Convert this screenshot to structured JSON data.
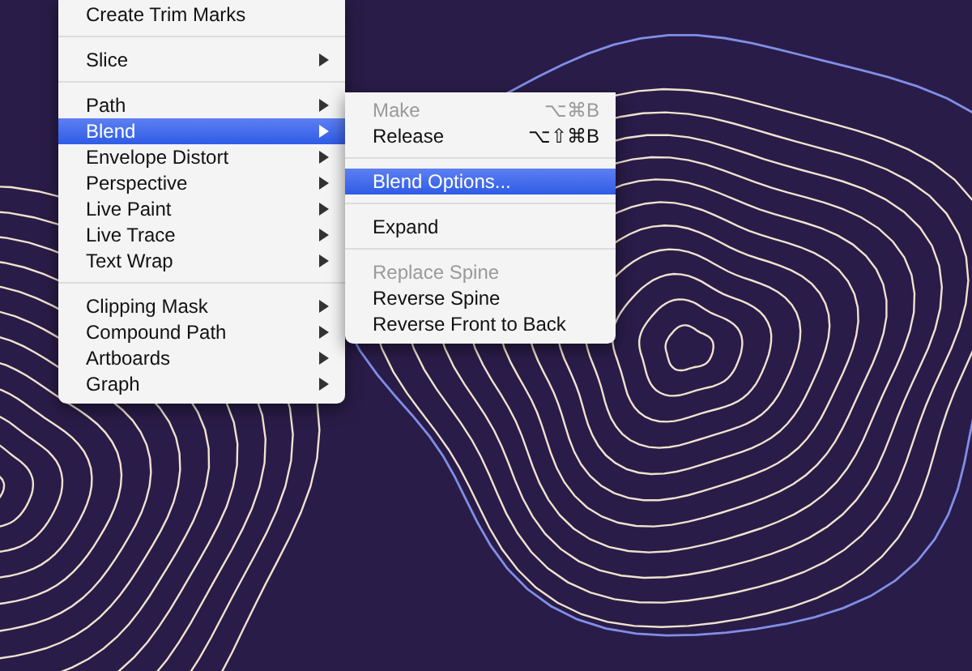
{
  "menu": {
    "items": [
      {
        "kind": "item",
        "label": "Create Trim Marks",
        "submenu": false,
        "selected": false
      },
      {
        "kind": "separator"
      },
      {
        "kind": "item",
        "label": "Slice",
        "submenu": true,
        "selected": false
      },
      {
        "kind": "separator"
      },
      {
        "kind": "item",
        "label": "Path",
        "submenu": true,
        "selected": false
      },
      {
        "kind": "item",
        "label": "Blend",
        "submenu": true,
        "selected": true
      },
      {
        "kind": "item",
        "label": "Envelope Distort",
        "submenu": true,
        "selected": false
      },
      {
        "kind": "item",
        "label": "Perspective",
        "submenu": true,
        "selected": false
      },
      {
        "kind": "item",
        "label": "Live Paint",
        "submenu": true,
        "selected": false
      },
      {
        "kind": "item",
        "label": "Live Trace",
        "submenu": true,
        "selected": false
      },
      {
        "kind": "item",
        "label": "Text Wrap",
        "submenu": true,
        "selected": false
      },
      {
        "kind": "separator"
      },
      {
        "kind": "item",
        "label": "Clipping Mask",
        "submenu": true,
        "selected": false
      },
      {
        "kind": "item",
        "label": "Compound Path",
        "submenu": true,
        "selected": false
      },
      {
        "kind": "item",
        "label": "Artboards",
        "submenu": true,
        "selected": false
      },
      {
        "kind": "item",
        "label": "Graph",
        "submenu": true,
        "selected": false
      }
    ]
  },
  "submenu": {
    "items": [
      {
        "kind": "item",
        "label": "Make",
        "shortcut": "⌥⌘B",
        "disabled": true,
        "selected": false
      },
      {
        "kind": "item",
        "label": "Release",
        "shortcut": "⌥⇧⌘B",
        "disabled": false,
        "selected": false
      },
      {
        "kind": "separator"
      },
      {
        "kind": "item",
        "label": "Blend Options...",
        "disabled": false,
        "selected": true
      },
      {
        "kind": "separator"
      },
      {
        "kind": "item",
        "label": "Expand",
        "disabled": false,
        "selected": false
      },
      {
        "kind": "separator"
      },
      {
        "kind": "item",
        "label": "Replace Spine",
        "disabled": true,
        "selected": false
      },
      {
        "kind": "item",
        "label": "Reverse Spine",
        "disabled": false,
        "selected": false
      },
      {
        "kind": "item",
        "label": "Reverse Front to Back",
        "disabled": false,
        "selected": false
      }
    ]
  }
}
